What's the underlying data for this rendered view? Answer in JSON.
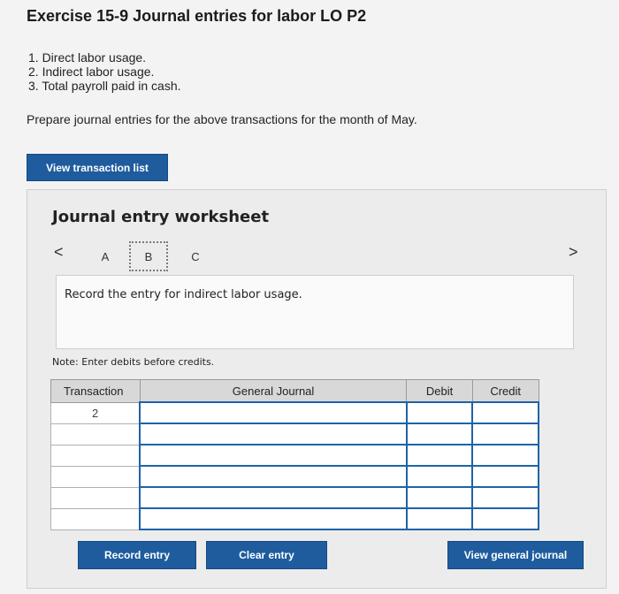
{
  "exercise_title": "Exercise 15-9 Journal entries for labor LO P2",
  "steps": [
    "1. Direct labor usage.",
    "2. Indirect labor usage.",
    "3. Total payroll paid in cash."
  ],
  "prompt": "Prepare journal entries for the above transactions for the month of May.",
  "view_transaction_list": "View transaction list",
  "worksheet": {
    "title": "Journal entry worksheet",
    "nav_prev": "<",
    "nav_next": ">",
    "tabs": [
      "A",
      "B",
      "C"
    ],
    "active_tab": "B",
    "instruction": "Record the entry for indirect labor usage.",
    "note": "Note: Enter debits before credits."
  },
  "table": {
    "headers": [
      "Transaction",
      "General Journal",
      "Debit",
      "Credit"
    ],
    "rows": [
      {
        "transaction": "2",
        "account": "",
        "debit": "",
        "credit": ""
      },
      {
        "transaction": "",
        "account": "",
        "debit": "",
        "credit": ""
      },
      {
        "transaction": "",
        "account": "",
        "debit": "",
        "credit": ""
      },
      {
        "transaction": "",
        "account": "",
        "debit": "",
        "credit": ""
      },
      {
        "transaction": "",
        "account": "",
        "debit": "",
        "credit": ""
      },
      {
        "transaction": "",
        "account": "",
        "debit": "",
        "credit": ""
      }
    ]
  },
  "buttons": {
    "record_entry": "Record entry",
    "clear_entry": "Clear entry",
    "view_general_journal": "View general journal"
  }
}
